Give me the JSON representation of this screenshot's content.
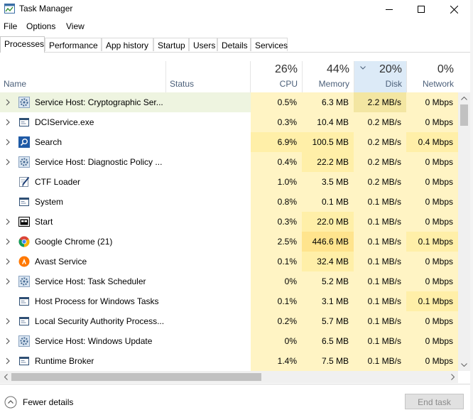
{
  "window": {
    "title": "Task Manager"
  },
  "menu": [
    "File",
    "Options",
    "View"
  ],
  "tabs": [
    "Processes",
    "Performance",
    "App history",
    "Startup",
    "Users",
    "Details",
    "Services"
  ],
  "active_tab": "Processes",
  "columns": {
    "name": "Name",
    "status": "Status",
    "cpu": {
      "pct": "26%",
      "label": "CPU"
    },
    "memory": {
      "pct": "44%",
      "label": "Memory"
    },
    "disk": {
      "pct": "20%",
      "label": "Disk"
    },
    "network": {
      "pct": "0%",
      "label": "Network"
    }
  },
  "sorted_column": "Disk",
  "processes": [
    {
      "name": "Service Host: Cryptographic Ser...",
      "icon": "gear-icon",
      "expandable": true,
      "cpu": "0.5%",
      "memory": "6.3 MB",
      "disk": "2.2 MB/s",
      "network": "0 Mbps"
    },
    {
      "name": "DCIService.exe",
      "icon": "window-app-icon",
      "expandable": true,
      "cpu": "0.3%",
      "memory": "10.4 MB",
      "disk": "0.2 MB/s",
      "network": "0 Mbps"
    },
    {
      "name": "Search",
      "icon": "search-icon",
      "expandable": true,
      "cpu": "6.9%",
      "memory": "100.5 MB",
      "disk": "0.2 MB/s",
      "network": "0.4 Mbps"
    },
    {
      "name": "Service Host: Diagnostic Policy ...",
      "icon": "gear-icon",
      "expandable": true,
      "cpu": "0.4%",
      "memory": "22.2 MB",
      "disk": "0.2 MB/s",
      "network": "0 Mbps"
    },
    {
      "name": "CTF Loader",
      "icon": "pen-icon",
      "expandable": false,
      "cpu": "1.0%",
      "memory": "3.5 MB",
      "disk": "0.2 MB/s",
      "network": "0 Mbps"
    },
    {
      "name": "System",
      "icon": "window-app-icon",
      "expandable": false,
      "cpu": "0.8%",
      "memory": "0.1 MB",
      "disk": "0.1 MB/s",
      "network": "0 Mbps"
    },
    {
      "name": "Start",
      "icon": "start-icon",
      "expandable": true,
      "cpu": "0.3%",
      "memory": "22.0 MB",
      "disk": "0.1 MB/s",
      "network": "0 Mbps"
    },
    {
      "name": "Google Chrome (21)",
      "icon": "chrome-icon",
      "expandable": true,
      "cpu": "2.5%",
      "memory": "446.6 MB",
      "disk": "0.1 MB/s",
      "network": "0.1 Mbps"
    },
    {
      "name": "Avast Service",
      "icon": "avast-icon",
      "expandable": true,
      "cpu": "0.1%",
      "memory": "32.4 MB",
      "disk": "0.1 MB/s",
      "network": "0 Mbps"
    },
    {
      "name": "Service Host: Task Scheduler",
      "icon": "gear-icon",
      "expandable": true,
      "cpu": "0%",
      "memory": "5.2 MB",
      "disk": "0.1 MB/s",
      "network": "0 Mbps"
    },
    {
      "name": "Host Process for Windows Tasks",
      "icon": "window-app-icon",
      "expandable": false,
      "cpu": "0.1%",
      "memory": "3.1 MB",
      "disk": "0.1 MB/s",
      "network": "0.1 Mbps"
    },
    {
      "name": "Local Security Authority Process...",
      "icon": "window-app-icon",
      "expandable": true,
      "cpu": "0.2%",
      "memory": "5.7 MB",
      "disk": "0.1 MB/s",
      "network": "0 Mbps"
    },
    {
      "name": "Service Host: Windows Update",
      "icon": "gear-icon",
      "expandable": true,
      "cpu": "0%",
      "memory": "6.5 MB",
      "disk": "0.1 MB/s",
      "network": "0 Mbps"
    },
    {
      "name": "Runtime Broker",
      "icon": "window-app-icon",
      "expandable": true,
      "cpu": "1.4%",
      "memory": "7.5 MB",
      "disk": "0.1 MB/s",
      "network": "0 Mbps"
    }
  ],
  "footer": {
    "fewer_details": "Fewer details",
    "end_task": "End task"
  },
  "colors": {
    "heat_light": "#fff4c4",
    "heat_mid": "#ffefa8",
    "heat_strong": "#f9e79a",
    "selected_row": "#eef4e0",
    "sorted_header": "#dceaf7",
    "header_label": "#4c607a"
  }
}
